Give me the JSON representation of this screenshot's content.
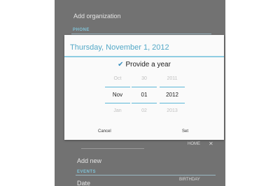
{
  "background": {
    "add_org": "Add organization",
    "phone_header": "PHONE",
    "home_label": "HOME",
    "add_new": "Add new",
    "events_header": "EVENTS",
    "date_label": "Date",
    "birthday_label": "BIRTHDAY"
  },
  "dialog": {
    "title": "Thursday, November 1, 2012",
    "provide_year": "Provide a year",
    "month": {
      "prev": "Oct",
      "current": "Nov",
      "next": "Jan"
    },
    "day": {
      "prev": "30",
      "current": "01",
      "next": "02"
    },
    "year": {
      "prev": "2011",
      "current": "2012",
      "next": "2013"
    },
    "cancel_label": "Cancel",
    "set_label": "Set"
  },
  "colors": {
    "accent": "#53a8c7",
    "divider": "#5bb7d8"
  },
  "icons": {
    "checkmark": "checkmark-icon",
    "close": "close-icon"
  }
}
